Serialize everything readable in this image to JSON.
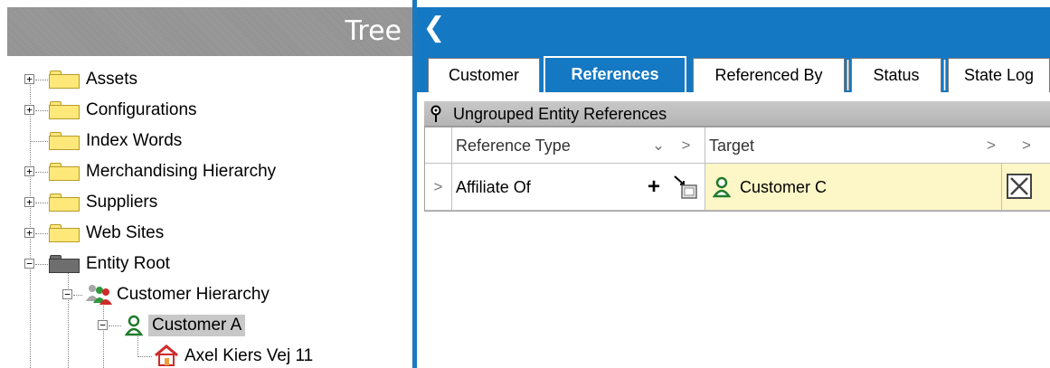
{
  "tree": {
    "title": "Tree",
    "items": [
      {
        "label": "Assets"
      },
      {
        "label": "Configurations"
      },
      {
        "label": "Index Words"
      },
      {
        "label": "Merchandising Hierarchy"
      },
      {
        "label": "Suppliers"
      },
      {
        "label": "Web Sites"
      },
      {
        "label": "Entity Root"
      },
      {
        "label": "Customer Hierarchy"
      },
      {
        "label": "Customer A"
      },
      {
        "label": "Axel Kiers Vej 11"
      }
    ],
    "expander_plus": "+",
    "expander_minus": "−"
  },
  "toolbar": {
    "back_glyph": "❮"
  },
  "tabs": [
    {
      "label": "Customer"
    },
    {
      "label": "References"
    },
    {
      "label": "Referenced By"
    },
    {
      "label": "Status"
    },
    {
      "label": "State Log"
    }
  ],
  "group": {
    "label": "Ungrouped Entity References"
  },
  "grid": {
    "columns": {
      "reference_type": "Reference Type",
      "target": "Target"
    },
    "chevron_right": ">",
    "chevron_down": "⌄",
    "rows": [
      {
        "reference_type": "Affiliate Of",
        "add_glyph": "+",
        "target": "Customer C"
      }
    ]
  },
  "colors": {
    "accent": "#1478c3",
    "folder": "#ffe87a",
    "target_highlight": "#fdf6c6",
    "selection": "#c8c8c8"
  }
}
